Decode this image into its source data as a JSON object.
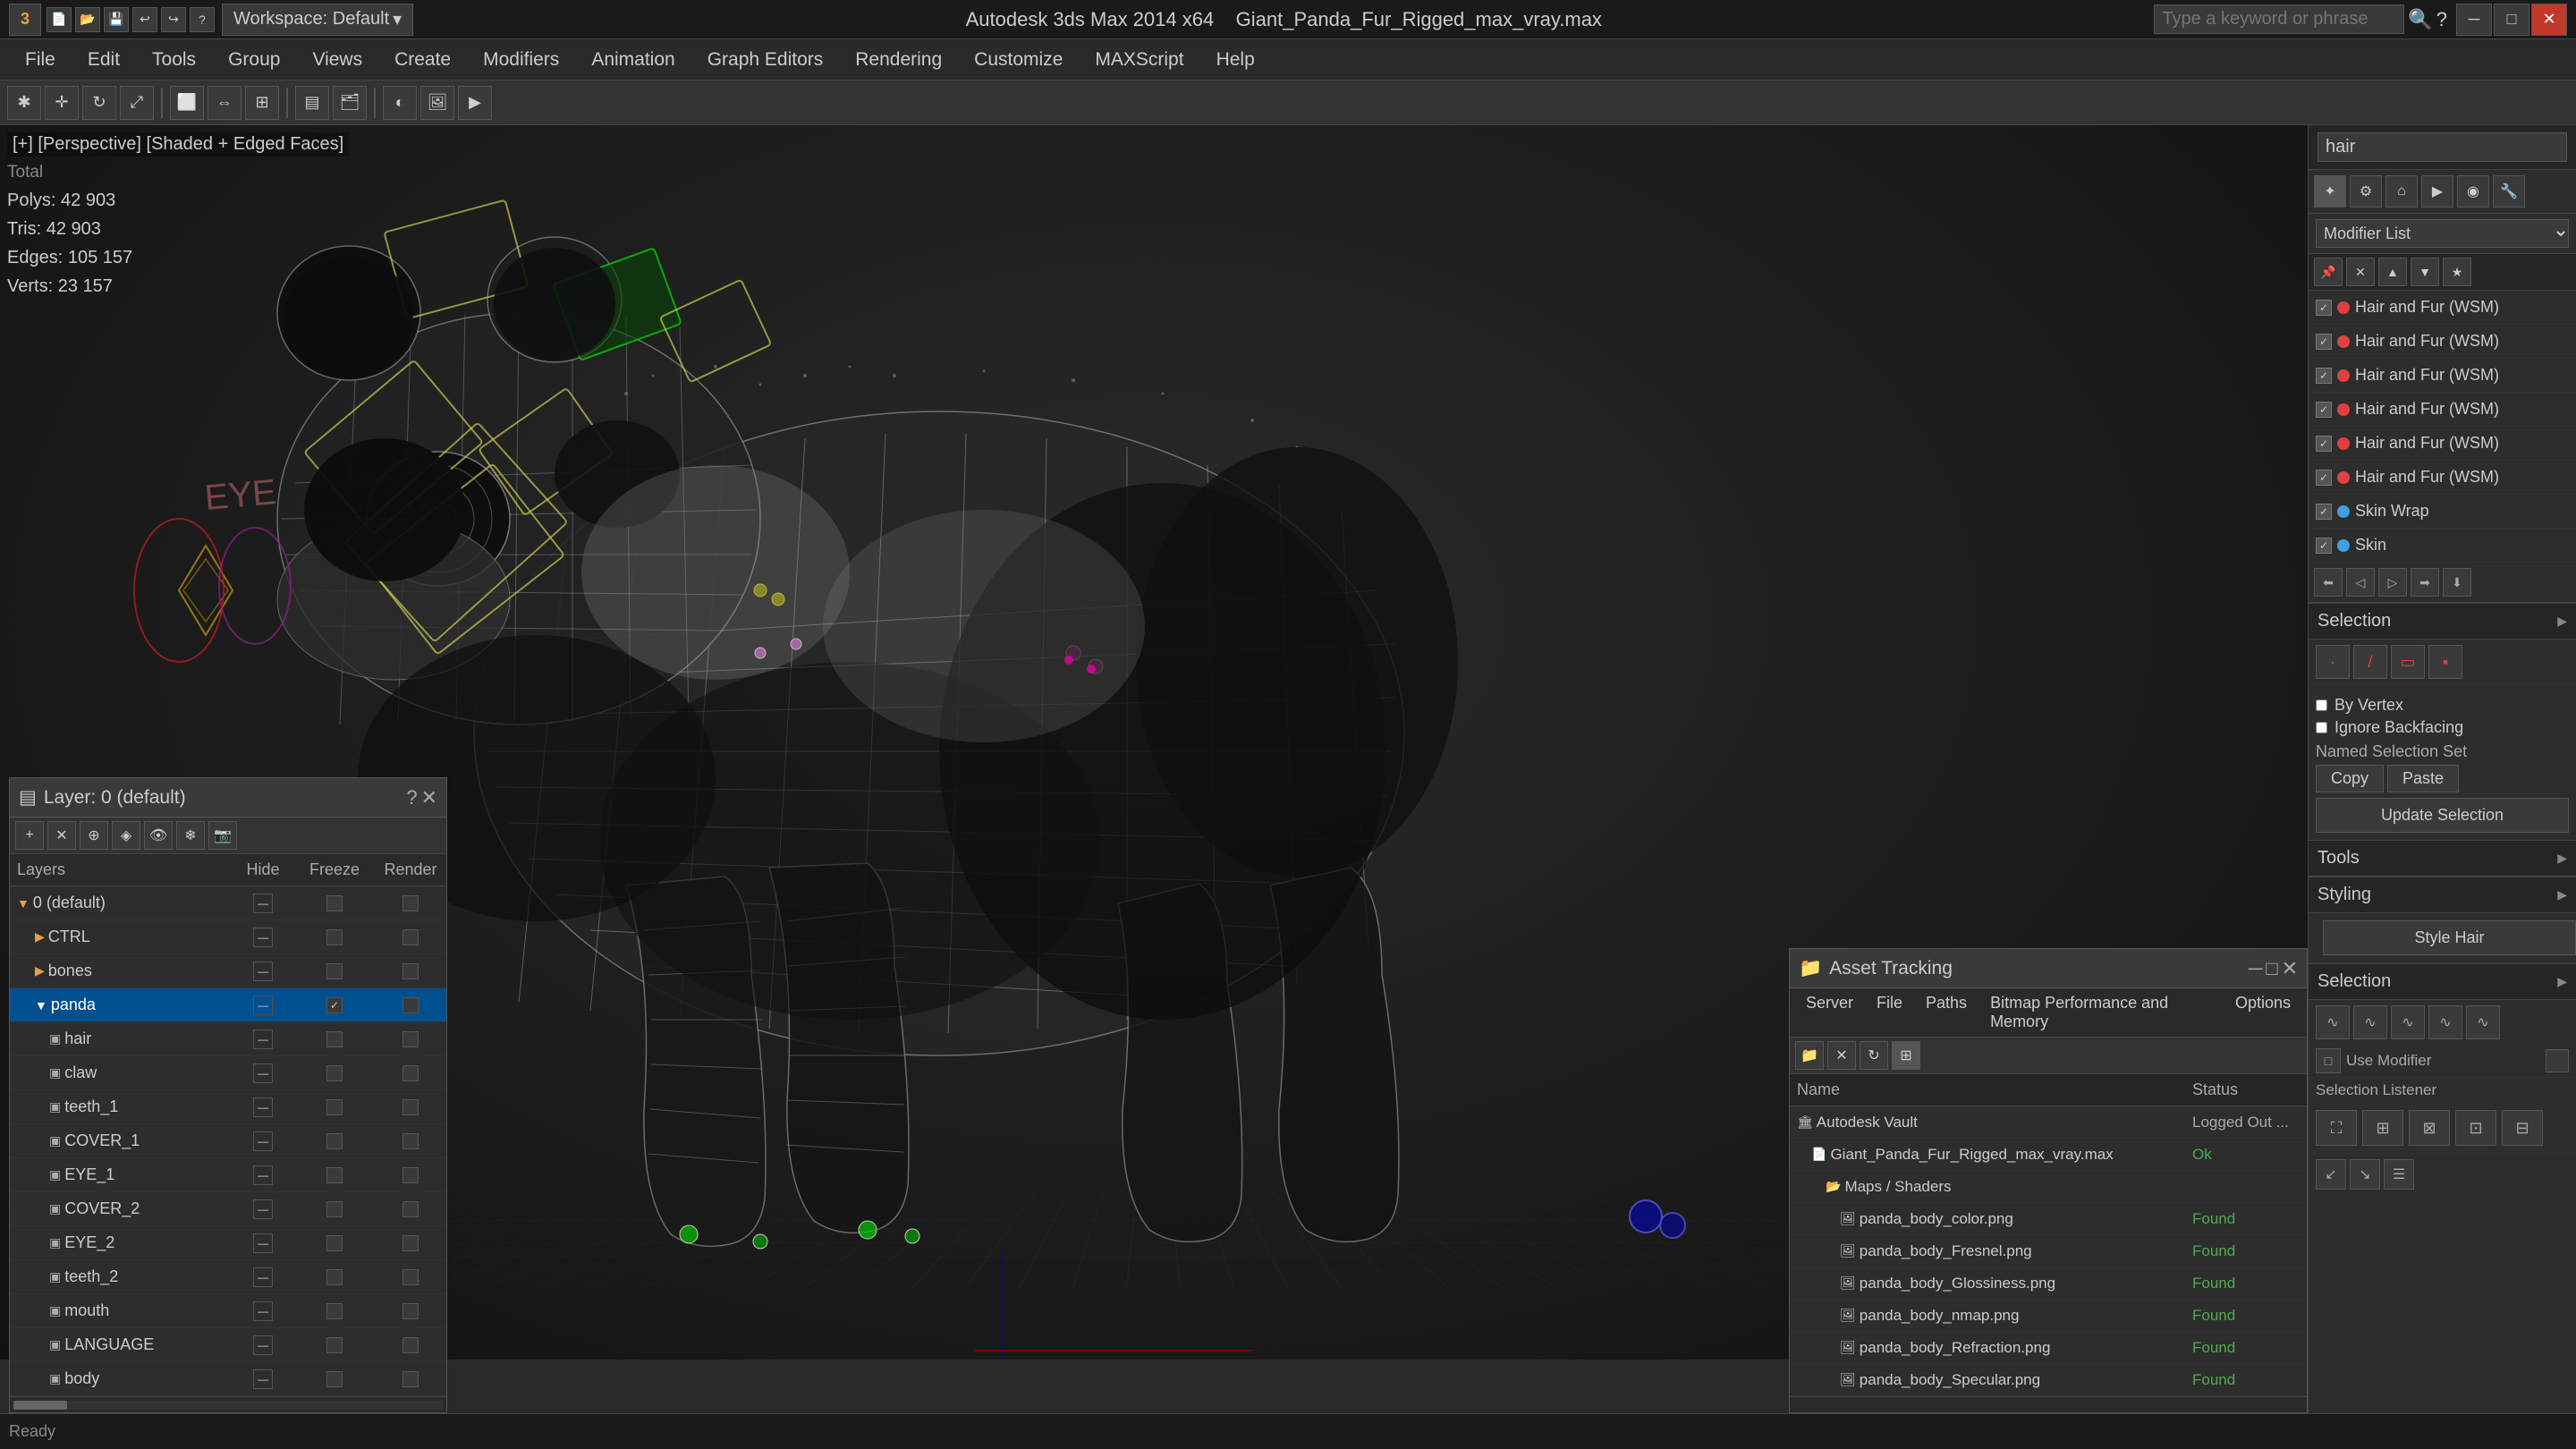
{
  "app": {
    "title": "Giant_Panda_Fur_Rigged_max_vray.max",
    "workspace": "Workspace: Default",
    "logo": "3"
  },
  "title_bar": {
    "file": "Autodesk 3ds Max 2014 x64",
    "filename": "Giant_Panda_Fur_Rigged_max_vray.max",
    "search_placeholder": "Type a keyword or phrase"
  },
  "menu": {
    "items": [
      "File",
      "Edit",
      "Tools",
      "Group",
      "Views",
      "Create",
      "Modifiers",
      "Animation",
      "Graph Editors",
      "Rendering",
      "Customize",
      "MAXScript",
      "Help"
    ]
  },
  "viewport": {
    "label": "[+] [Perspective] [Shaded + Edged Faces]",
    "stats": {
      "polys_label": "Polys:",
      "polys_value": "42 903",
      "tris_label": "Tris:",
      "tris_value": "42 903",
      "edges_label": "Edges:",
      "edges_value": "105 157",
      "verts_label": "Verts:",
      "verts_value": "23 157"
    }
  },
  "right_panel": {
    "name_field": "hair",
    "modifier_list_label": "Modifier List",
    "modifiers": [
      {
        "name": "Hair and Fur (WSM)",
        "checked": true,
        "color": "#e04040"
      },
      {
        "name": "Hair and Fur (WSM)",
        "checked": true,
        "color": "#e04040"
      },
      {
        "name": "Hair and Fur (WSM)",
        "checked": true,
        "color": "#e04040"
      },
      {
        "name": "Hair and Fur (WSM)",
        "checked": true,
        "color": "#e04040"
      },
      {
        "name": "Hair and Fur (WSM)",
        "checked": true,
        "color": "#e04040"
      },
      {
        "name": "Hair and Fur (WSM)",
        "checked": true,
        "color": "#e04040"
      },
      {
        "name": "Skin Wrap",
        "checked": true,
        "color": "#40a0e0"
      },
      {
        "name": "Skin",
        "checked": true,
        "color": "#40a0e0"
      }
    ],
    "sections": {
      "selection": "Selection",
      "tools": "Tools",
      "styling": "Styling",
      "selection2": "Selection"
    },
    "named_selection_set": "Named Selection Set",
    "copy_btn": "Copy",
    "paste_btn": "Paste",
    "update_selection_btn": "Update Selection",
    "style_hair_btn": "Style Hair"
  },
  "layers_panel": {
    "title": "Layer: 0 (default)",
    "close_btn": "?",
    "columns": {
      "layers": "Layers",
      "hide": "Hide",
      "freeze": "Freeze",
      "render": "Render"
    },
    "rows": [
      {
        "name": "0 (default)",
        "indent": 0,
        "type": "folder",
        "expanded": true
      },
      {
        "name": "CTRL",
        "indent": 1,
        "type": "folder",
        "expanded": false
      },
      {
        "name": "bones",
        "indent": 1,
        "type": "folder",
        "expanded": false
      },
      {
        "name": "panda",
        "indent": 1,
        "type": "folder",
        "expanded": true,
        "active": true
      },
      {
        "name": "hair",
        "indent": 2,
        "type": "obj"
      },
      {
        "name": "claw",
        "indent": 2,
        "type": "obj"
      },
      {
        "name": "teeth_1",
        "indent": 2,
        "type": "obj"
      },
      {
        "name": "COVER_1",
        "indent": 2,
        "type": "obj"
      },
      {
        "name": "EYE_1",
        "indent": 2,
        "type": "obj"
      },
      {
        "name": "COVER_2",
        "indent": 2,
        "type": "obj"
      },
      {
        "name": "EYE_2",
        "indent": 2,
        "type": "obj"
      },
      {
        "name": "teeth_2",
        "indent": 2,
        "type": "obj"
      },
      {
        "name": "mouth",
        "indent": 2,
        "type": "obj"
      },
      {
        "name": "LANGUAGE",
        "indent": 2,
        "type": "obj"
      },
      {
        "name": "body",
        "indent": 2,
        "type": "obj"
      }
    ]
  },
  "asset_panel": {
    "title": "Asset Tracking",
    "menu_items": [
      "Server",
      "File",
      "Paths",
      "Bitmap Performance and Memory",
      "Options"
    ],
    "columns": {
      "name": "Name",
      "status": "Status"
    },
    "rows": [
      {
        "name": "Autodesk Vault",
        "status": "Logged Out...",
        "indent": 0,
        "type": "vault",
        "status_class": "loggedout"
      },
      {
        "name": "Giant_Panda_Fur_Rigged_max_vray.max",
        "status": "Ok",
        "indent": 1,
        "type": "file",
        "status_class": "ok"
      },
      {
        "name": "Maps / Shaders",
        "status": "",
        "indent": 2,
        "type": "folder"
      },
      {
        "name": "panda_body_color.png",
        "status": "Found",
        "indent": 3,
        "type": "img",
        "status_class": "found"
      },
      {
        "name": "panda_body_Fresnel.png",
        "status": "Found",
        "indent": 3,
        "type": "img",
        "status_class": "found"
      },
      {
        "name": "panda_body_Glossiness.png",
        "status": "Found",
        "indent": 3,
        "type": "img",
        "status_class": "found"
      },
      {
        "name": "panda_body_nmap.png",
        "status": "Found",
        "indent": 3,
        "type": "img",
        "status_class": "found"
      },
      {
        "name": "panda_body_Refraction.png",
        "status": "Found",
        "indent": 3,
        "type": "img",
        "status_class": "found"
      },
      {
        "name": "panda_body_Specular.png",
        "status": "Found",
        "indent": 3,
        "type": "img",
        "status_class": "found"
      }
    ]
  }
}
